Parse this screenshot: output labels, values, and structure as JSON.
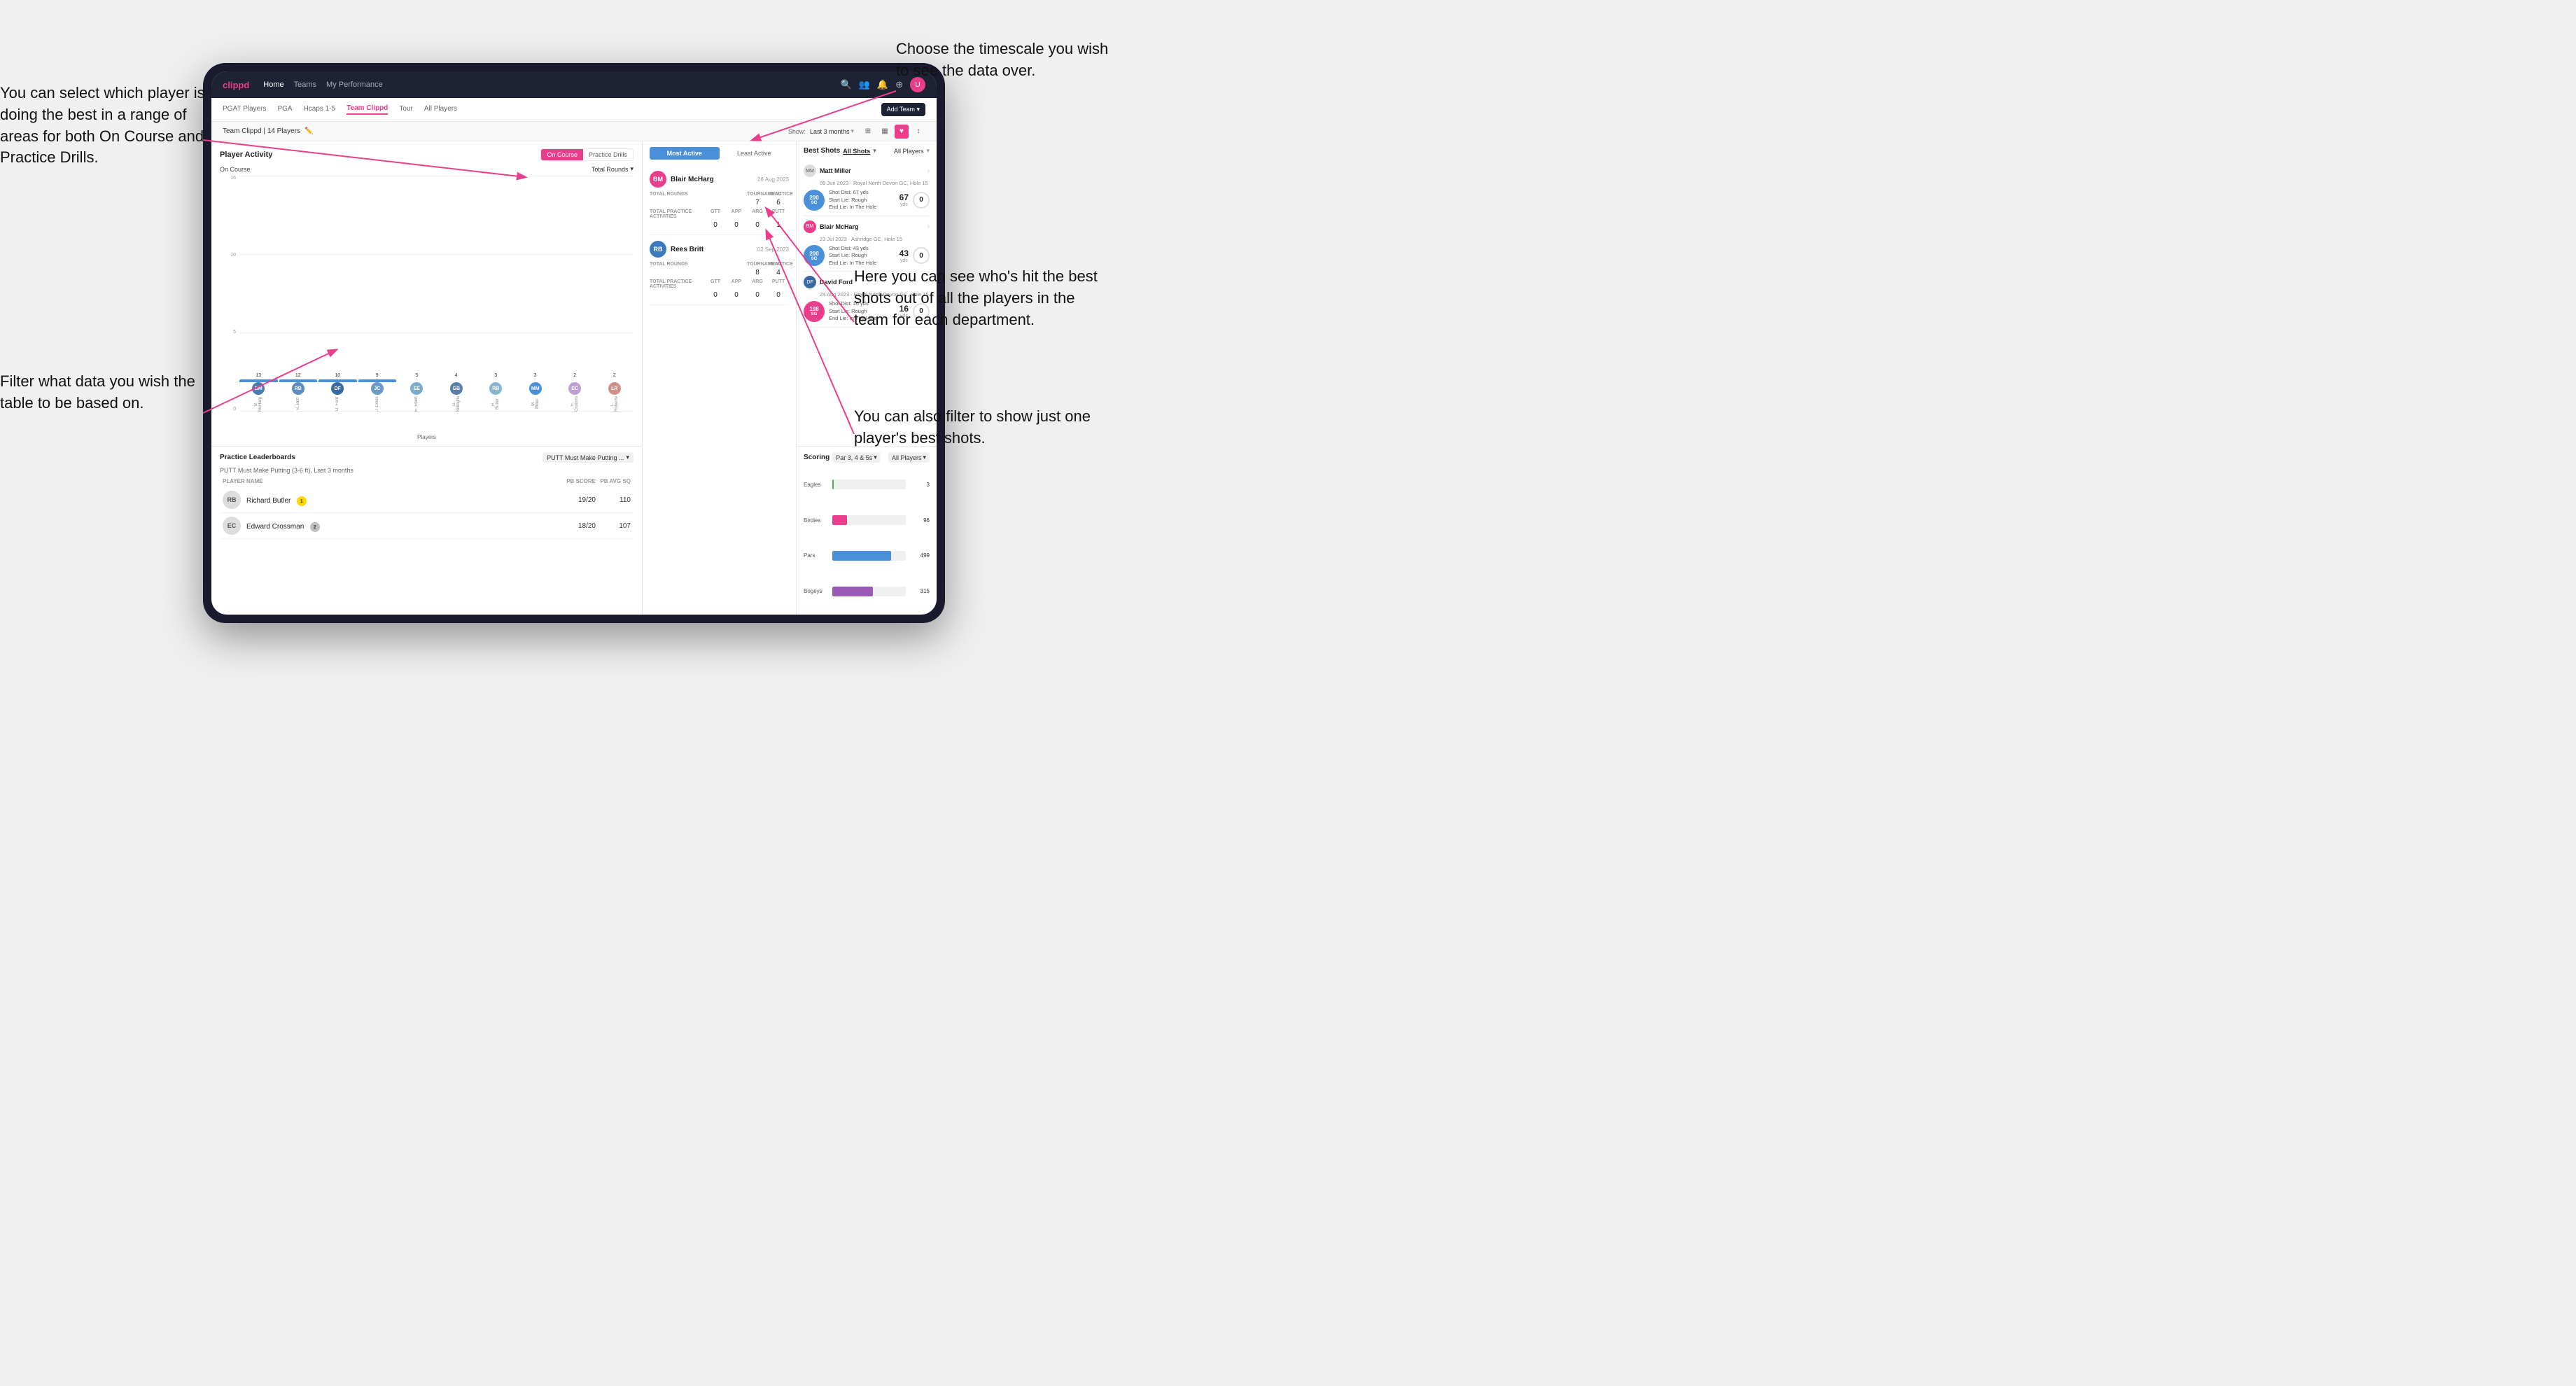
{
  "annotations": {
    "top_right_title": "Choose the timescale you\nwish to see the data over.",
    "top_left_title": "You can select which player is\ndoing the best in a range of\nareas for both On Course and\nPractice Drills.",
    "bottom_left_title": "Filter what data you wish the\ntable to be based on.",
    "bottom_right_title": "Here you can see who's hit\nthe best shots out of all the\nplayers in the team for\neach department.",
    "filter_title": "You can also filter to show\njust one player's best shots."
  },
  "nav": {
    "logo": "clippd",
    "links": [
      "Home",
      "Teams",
      "My Performance"
    ],
    "tabs": [
      "PGAT Players",
      "PGA",
      "Hcaps 1-5",
      "Team Clippd",
      "Tour",
      "All Players"
    ],
    "active_tab": "Team Clippd",
    "add_team_btn": "Add Team ▾"
  },
  "team_header": {
    "team_name": "Team Clippd | 14 Players",
    "show_label": "Show:",
    "show_value": "Last 3 months",
    "view_icons": [
      "⊞",
      "▦",
      "♥",
      "↕"
    ]
  },
  "player_activity": {
    "title": "Player Activity",
    "toggle": [
      "On Course",
      "Practice Drills"
    ],
    "active_toggle": "On Course",
    "chart_section_label": "On Course",
    "chart_dropdown": "Total Rounds",
    "y_labels": [
      "15",
      "10",
      "5",
      "0"
    ],
    "y_axis_title": "Total Rounds",
    "players_label": "Players",
    "bars": [
      {
        "name": "B. McHarg",
        "value": 13,
        "initials": "BM",
        "color": "#b0c8e0"
      },
      {
        "name": "R. Britt",
        "value": 12,
        "initials": "RB",
        "color": "#b0c8e0"
      },
      {
        "name": "D. Ford",
        "value": 10,
        "initials": "DF",
        "color": "#b0c8e0"
      },
      {
        "name": "J. Coles",
        "value": 9,
        "initials": "JC",
        "color": "#b0c8e0"
      },
      {
        "name": "E. Ebert",
        "value": 5,
        "initials": "EE",
        "color": "#b0c8e0"
      },
      {
        "name": "G. Billingham",
        "value": 4,
        "initials": "GB",
        "color": "#b0c8e0"
      },
      {
        "name": "R. Butler",
        "value": 3,
        "initials": "RB2",
        "color": "#b0c8e0"
      },
      {
        "name": "M. Miller",
        "value": 3,
        "initials": "MM",
        "color": "#b0c8e0"
      },
      {
        "name": "E. Crossman",
        "value": 2,
        "initials": "EC",
        "color": "#b0c8e0"
      },
      {
        "name": "L. Robertson",
        "value": 2,
        "initials": "LR",
        "color": "#b0c8e0"
      }
    ]
  },
  "leaderboard": {
    "title": "Practice Leaderboards",
    "dropdown": "PUTT Must Make Putting ...",
    "subtitle": "PUTT Must Make Putting (3-6 ft), Last 3 months",
    "columns": [
      "PLAYER NAME",
      "PB SCORE",
      "PB AVG SQ"
    ],
    "players": [
      {
        "name": "Richard Butler",
        "initials": "RB",
        "badge": "1",
        "badge_type": "gold",
        "score": "19/20",
        "avg": "110"
      },
      {
        "name": "Edward Crossman",
        "initials": "EC",
        "badge": "2",
        "badge_type": "silver",
        "score": "18/20",
        "avg": "107"
      }
    ]
  },
  "most_active": {
    "tabs": [
      "Most Active",
      "Least Active"
    ],
    "active_tab": "Most Active",
    "players": [
      {
        "name": "Blair McHarg",
        "initials": "BM",
        "date": "26 Aug 2023",
        "total_rounds_label": "Total Rounds",
        "tournament": "7",
        "practice": "6",
        "total_practice_label": "Total Practice Activities",
        "gtt": "0",
        "app": "0",
        "arg": "0",
        "putt": "1"
      },
      {
        "name": "Rees Britt",
        "initials": "RB",
        "date": "02 Sep 2023",
        "total_rounds_label": "Total Rounds",
        "tournament": "8",
        "practice": "4",
        "total_practice_label": "Total Practice Activities",
        "gtt": "0",
        "app": "0",
        "arg": "0",
        "putt": "0"
      }
    ]
  },
  "best_shots": {
    "title": "Best Shots",
    "tabs": [
      "All Shots",
      "All Players"
    ],
    "shots": [
      {
        "player": "Matt Miller",
        "initials": "MM",
        "course": "09 Jun 2023 · Royal North Devon GC, Hole 15",
        "badge_val": "200",
        "badge_sub": "SG",
        "badge_color": "blue",
        "dist_label": "Shot Dist: 67 yds",
        "start_lie": "Start Lie: Rough",
        "end_lie": "End Lie: In The Hole",
        "stat1_val": "67",
        "stat1_unit": "yds",
        "stat2_val": "0",
        "stat2_unit": "yds"
      },
      {
        "player": "Blair McHarg",
        "initials": "BM",
        "course": "23 Jul 2023 · Ashridge GC, Hole 15",
        "badge_val": "200",
        "badge_sub": "SG",
        "badge_color": "blue",
        "dist_label": "Shot Dist: 43 yds",
        "start_lie": "Start Lie: Rough",
        "end_lie": "End Lie: In The Hole",
        "stat1_val": "43",
        "stat1_unit": "yds",
        "stat2_val": "0",
        "stat2_unit": "yds"
      },
      {
        "player": "David Ford",
        "initials": "DF",
        "course": "24 Aug 2023 · Royal North Devon GC, Hole 15",
        "badge_val": "198",
        "badge_sub": "SG",
        "badge_color": "pink",
        "dist_label": "Shot Dist: 16 yds",
        "start_lie": "Start Lie: Rough",
        "end_lie": "End Lie: In The Hole",
        "stat1_val": "16",
        "stat1_unit": "yds",
        "stat2_val": "0",
        "stat2_unit": "yds"
      }
    ]
  },
  "scoring": {
    "title": "Scoring",
    "dropdown1": "Par 3, 4 & 5s",
    "dropdown2": "All Players",
    "rows": [
      {
        "label": "Eagles",
        "count": "3",
        "fill_pct": 2,
        "color": "#4CAF50"
      },
      {
        "label": "Birdies",
        "count": "96",
        "fill_pct": 20,
        "color": "#e83e8c"
      },
      {
        "label": "Pars",
        "count": "499",
        "fill_pct": 80,
        "color": "#4a90d9"
      },
      {
        "label": "Bogeys",
        "count": "315",
        "fill_pct": 55,
        "color": "#9b59b6"
      }
    ]
  }
}
